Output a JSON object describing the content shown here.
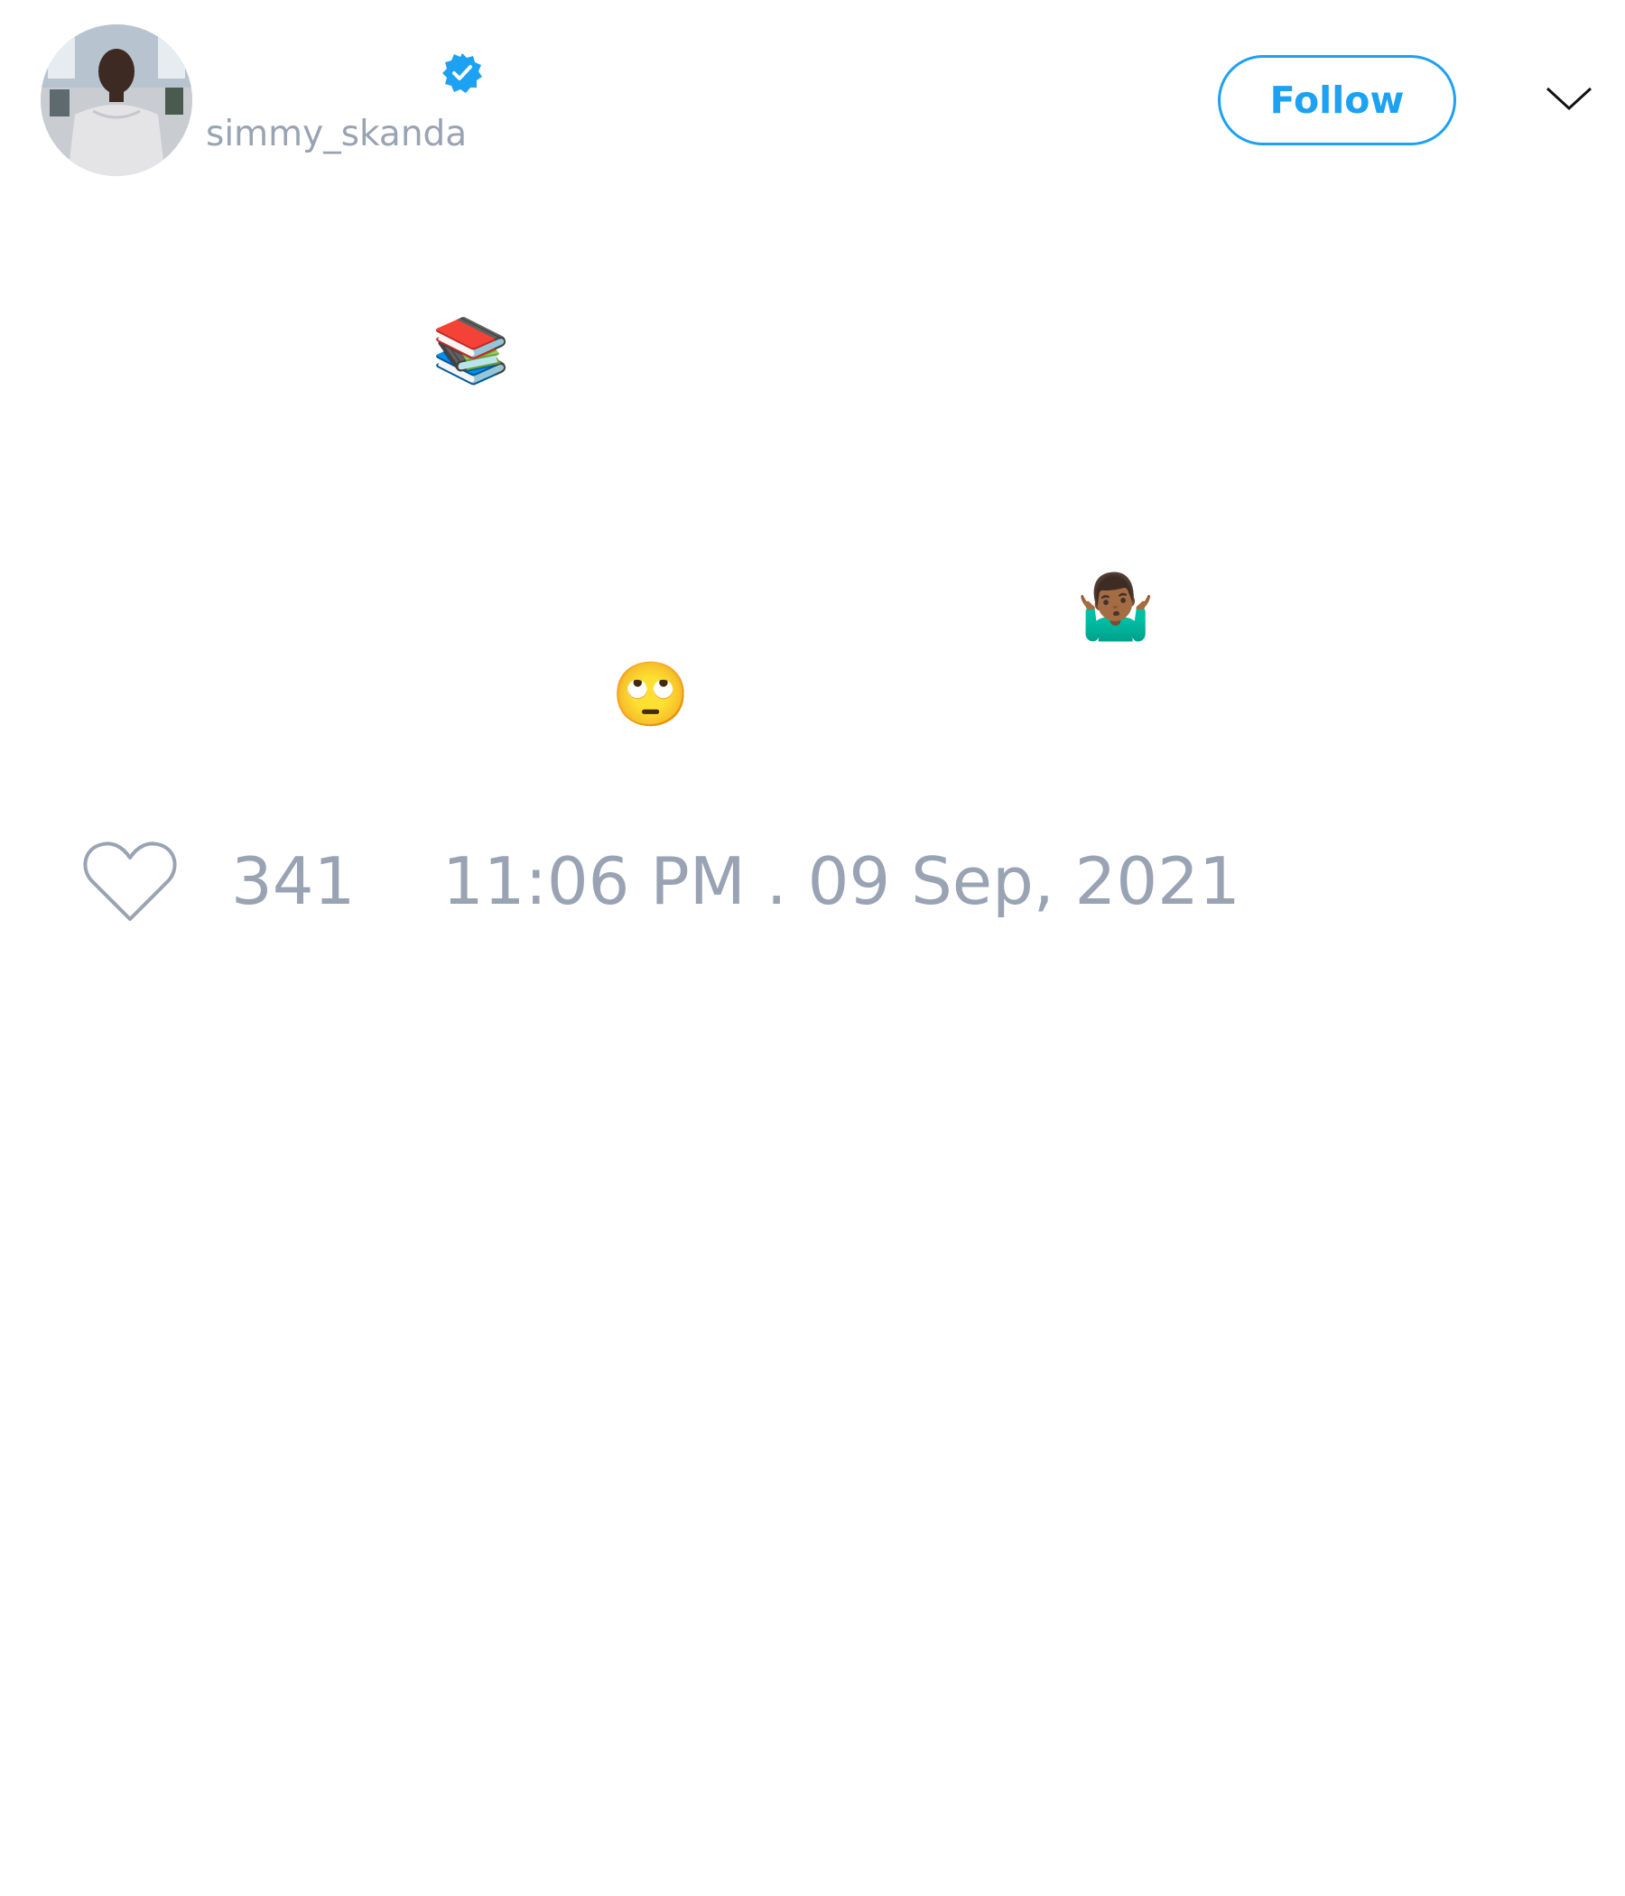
{
  "author": {
    "handle": "simmy_skanda",
    "verified": true,
    "avatar_icon": "profile-photo"
  },
  "header": {
    "follow_label": "Follow",
    "menu_icon": "chevron-down-icon"
  },
  "tweet": {
    "emojis": [
      "📚",
      "🤷🏾‍♂️",
      "🙄"
    ]
  },
  "footer": {
    "like_icon": "heart-outline-icon",
    "like_count": "341",
    "timestamp": "11:06 PM . 09 Sep, 2021"
  },
  "colors": {
    "accent": "#1da1f2",
    "muted_text": "#99a3b3"
  }
}
